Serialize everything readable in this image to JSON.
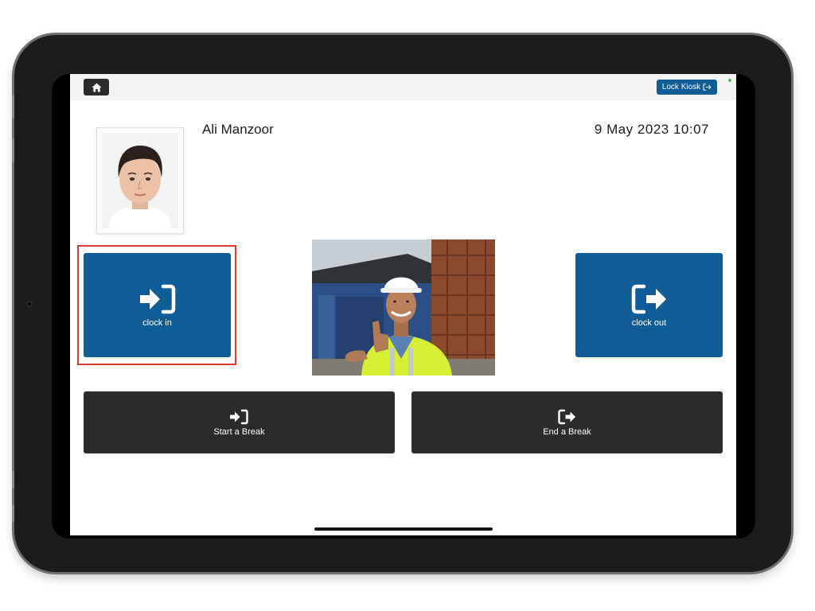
{
  "topbar": {
    "home_icon": "home-icon",
    "lock_label": "Lock Kiosk",
    "lock_icon": "logout-icon"
  },
  "user": {
    "name": "Ali Manzoor",
    "datetime": "9 May 2023 10:07"
  },
  "actions": {
    "clock_in_label": "clock in",
    "clock_out_label": "clock out",
    "start_break_label": "Start a Break",
    "end_break_label": "End a Break"
  },
  "colors": {
    "primary": "#0f5c96",
    "dark": "#2b2b2b",
    "highlight": "#e23a2a"
  }
}
